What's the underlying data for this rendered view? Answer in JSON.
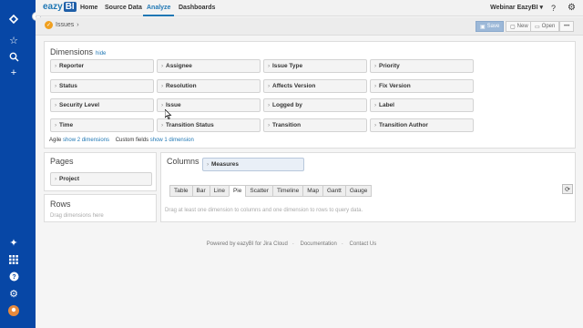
{
  "nav": {
    "logo": "eazy",
    "logo_bi": "BI",
    "tabs": [
      "Home",
      "Source Data",
      "Analyze",
      "Dashboards"
    ],
    "user": "Webinar EazyBI ▾",
    "help": "?",
    "settings": "⚙"
  },
  "breadcrumb": {
    "label": "Issues",
    "separator": "›"
  },
  "toolbar": {
    "save": "Save",
    "new": "New",
    "open": "Open",
    "more": "•••"
  },
  "dimensions": {
    "title": "Dimensions",
    "hide": "hide",
    "items": [
      [
        "Reporter",
        "Assignee",
        "Issue Type",
        "Priority"
      ],
      [
        "Status",
        "Resolution",
        "Affects Version",
        "Fix Version"
      ],
      [
        "Security Level",
        "Issue",
        "Logged by",
        "Label"
      ],
      [
        "Time",
        "Transition Status",
        "Transition",
        "Transition Author"
      ]
    ],
    "agile_label": "Agile",
    "agile_link": "show 2 dimensions",
    "custom_label": "Custom fields",
    "custom_link": "show 1 dimension"
  },
  "pages": {
    "title": "Pages",
    "item": "Project"
  },
  "columns": {
    "title": "Columns",
    "item": "Measures"
  },
  "rows": {
    "title": "Rows",
    "hint": "Drag dimensions here"
  },
  "report": {
    "tabs": [
      "Table",
      "Bar",
      "Line",
      "Pie",
      "Scatter",
      "Timeline",
      "Map",
      "Gantt",
      "Gauge"
    ],
    "active_tab": "Pie",
    "hint": "Drag at least one dimension to columns and one dimension to rows to query data."
  },
  "footer": {
    "powered": "Powered by eazyBI for Jira Cloud",
    "docs": "Documentation",
    "contact": "Contact Us"
  }
}
